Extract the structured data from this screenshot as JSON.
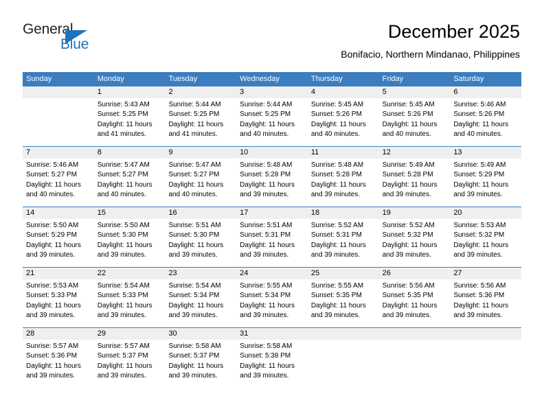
{
  "brand": {
    "name_top": "General",
    "name_bottom": "Blue",
    "accent_color": "#1e73be"
  },
  "header": {
    "title": "December 2025",
    "subtitle": "Bonifacio, Northern Mindanao, Philippines"
  },
  "theme": {
    "header_row_color": "#3c7dbf",
    "day_band_color": "#efefef",
    "text_color": "#000000"
  },
  "weekdays": [
    "Sunday",
    "Monday",
    "Tuesday",
    "Wednesday",
    "Thursday",
    "Friday",
    "Saturday"
  ],
  "labels": {
    "sunrise_prefix": "Sunrise:",
    "sunset_prefix": "Sunset:",
    "daylight_prefix": "Daylight:"
  },
  "weeks": [
    [
      {
        "day": "",
        "empty": true
      },
      {
        "day": "1",
        "sunrise": "Sunrise: 5:43 AM",
        "sunset": "Sunset: 5:25 PM",
        "daylight_1": "Daylight: 11 hours",
        "daylight_2": "and 41 minutes."
      },
      {
        "day": "2",
        "sunrise": "Sunrise: 5:44 AM",
        "sunset": "Sunset: 5:25 PM",
        "daylight_1": "Daylight: 11 hours",
        "daylight_2": "and 41 minutes."
      },
      {
        "day": "3",
        "sunrise": "Sunrise: 5:44 AM",
        "sunset": "Sunset: 5:25 PM",
        "daylight_1": "Daylight: 11 hours",
        "daylight_2": "and 40 minutes."
      },
      {
        "day": "4",
        "sunrise": "Sunrise: 5:45 AM",
        "sunset": "Sunset: 5:26 PM",
        "daylight_1": "Daylight: 11 hours",
        "daylight_2": "and 40 minutes."
      },
      {
        "day": "5",
        "sunrise": "Sunrise: 5:45 AM",
        "sunset": "Sunset: 5:26 PM",
        "daylight_1": "Daylight: 11 hours",
        "daylight_2": "and 40 minutes."
      },
      {
        "day": "6",
        "sunrise": "Sunrise: 5:46 AM",
        "sunset": "Sunset: 5:26 PM",
        "daylight_1": "Daylight: 11 hours",
        "daylight_2": "and 40 minutes."
      }
    ],
    [
      {
        "day": "7",
        "sunrise": "Sunrise: 5:46 AM",
        "sunset": "Sunset: 5:27 PM",
        "daylight_1": "Daylight: 11 hours",
        "daylight_2": "and 40 minutes."
      },
      {
        "day": "8",
        "sunrise": "Sunrise: 5:47 AM",
        "sunset": "Sunset: 5:27 PM",
        "daylight_1": "Daylight: 11 hours",
        "daylight_2": "and 40 minutes."
      },
      {
        "day": "9",
        "sunrise": "Sunrise: 5:47 AM",
        "sunset": "Sunset: 5:27 PM",
        "daylight_1": "Daylight: 11 hours",
        "daylight_2": "and 40 minutes."
      },
      {
        "day": "10",
        "sunrise": "Sunrise: 5:48 AM",
        "sunset": "Sunset: 5:28 PM",
        "daylight_1": "Daylight: 11 hours",
        "daylight_2": "and 39 minutes."
      },
      {
        "day": "11",
        "sunrise": "Sunrise: 5:48 AM",
        "sunset": "Sunset: 5:28 PM",
        "daylight_1": "Daylight: 11 hours",
        "daylight_2": "and 39 minutes."
      },
      {
        "day": "12",
        "sunrise": "Sunrise: 5:49 AM",
        "sunset": "Sunset: 5:28 PM",
        "daylight_1": "Daylight: 11 hours",
        "daylight_2": "and 39 minutes."
      },
      {
        "day": "13",
        "sunrise": "Sunrise: 5:49 AM",
        "sunset": "Sunset: 5:29 PM",
        "daylight_1": "Daylight: 11 hours",
        "daylight_2": "and 39 minutes."
      }
    ],
    [
      {
        "day": "14",
        "sunrise": "Sunrise: 5:50 AM",
        "sunset": "Sunset: 5:29 PM",
        "daylight_1": "Daylight: 11 hours",
        "daylight_2": "and 39 minutes."
      },
      {
        "day": "15",
        "sunrise": "Sunrise: 5:50 AM",
        "sunset": "Sunset: 5:30 PM",
        "daylight_1": "Daylight: 11 hours",
        "daylight_2": "and 39 minutes."
      },
      {
        "day": "16",
        "sunrise": "Sunrise: 5:51 AM",
        "sunset": "Sunset: 5:30 PM",
        "daylight_1": "Daylight: 11 hours",
        "daylight_2": "and 39 minutes."
      },
      {
        "day": "17",
        "sunrise": "Sunrise: 5:51 AM",
        "sunset": "Sunset: 5:31 PM",
        "daylight_1": "Daylight: 11 hours",
        "daylight_2": "and 39 minutes."
      },
      {
        "day": "18",
        "sunrise": "Sunrise: 5:52 AM",
        "sunset": "Sunset: 5:31 PM",
        "daylight_1": "Daylight: 11 hours",
        "daylight_2": "and 39 minutes."
      },
      {
        "day": "19",
        "sunrise": "Sunrise: 5:52 AM",
        "sunset": "Sunset: 5:32 PM",
        "daylight_1": "Daylight: 11 hours",
        "daylight_2": "and 39 minutes."
      },
      {
        "day": "20",
        "sunrise": "Sunrise: 5:53 AM",
        "sunset": "Sunset: 5:32 PM",
        "daylight_1": "Daylight: 11 hours",
        "daylight_2": "and 39 minutes."
      }
    ],
    [
      {
        "day": "21",
        "sunrise": "Sunrise: 5:53 AM",
        "sunset": "Sunset: 5:33 PM",
        "daylight_1": "Daylight: 11 hours",
        "daylight_2": "and 39 minutes."
      },
      {
        "day": "22",
        "sunrise": "Sunrise: 5:54 AM",
        "sunset": "Sunset: 5:33 PM",
        "daylight_1": "Daylight: 11 hours",
        "daylight_2": "and 39 minutes."
      },
      {
        "day": "23",
        "sunrise": "Sunrise: 5:54 AM",
        "sunset": "Sunset: 5:34 PM",
        "daylight_1": "Daylight: 11 hours",
        "daylight_2": "and 39 minutes."
      },
      {
        "day": "24",
        "sunrise": "Sunrise: 5:55 AM",
        "sunset": "Sunset: 5:34 PM",
        "daylight_1": "Daylight: 11 hours",
        "daylight_2": "and 39 minutes."
      },
      {
        "day": "25",
        "sunrise": "Sunrise: 5:55 AM",
        "sunset": "Sunset: 5:35 PM",
        "daylight_1": "Daylight: 11 hours",
        "daylight_2": "and 39 minutes."
      },
      {
        "day": "26",
        "sunrise": "Sunrise: 5:56 AM",
        "sunset": "Sunset: 5:35 PM",
        "daylight_1": "Daylight: 11 hours",
        "daylight_2": "and 39 minutes."
      },
      {
        "day": "27",
        "sunrise": "Sunrise: 5:56 AM",
        "sunset": "Sunset: 5:36 PM",
        "daylight_1": "Daylight: 11 hours",
        "daylight_2": "and 39 minutes."
      }
    ],
    [
      {
        "day": "28",
        "sunrise": "Sunrise: 5:57 AM",
        "sunset": "Sunset: 5:36 PM",
        "daylight_1": "Daylight: 11 hours",
        "daylight_2": "and 39 minutes."
      },
      {
        "day": "29",
        "sunrise": "Sunrise: 5:57 AM",
        "sunset": "Sunset: 5:37 PM",
        "daylight_1": "Daylight: 11 hours",
        "daylight_2": "and 39 minutes."
      },
      {
        "day": "30",
        "sunrise": "Sunrise: 5:58 AM",
        "sunset": "Sunset: 5:37 PM",
        "daylight_1": "Daylight: 11 hours",
        "daylight_2": "and 39 minutes."
      },
      {
        "day": "31",
        "sunrise": "Sunrise: 5:58 AM",
        "sunset": "Sunset: 5:38 PM",
        "daylight_1": "Daylight: 11 hours",
        "daylight_2": "and 39 minutes."
      },
      {
        "day": "",
        "empty": true
      },
      {
        "day": "",
        "empty": true
      },
      {
        "day": "",
        "empty": true
      }
    ]
  ]
}
